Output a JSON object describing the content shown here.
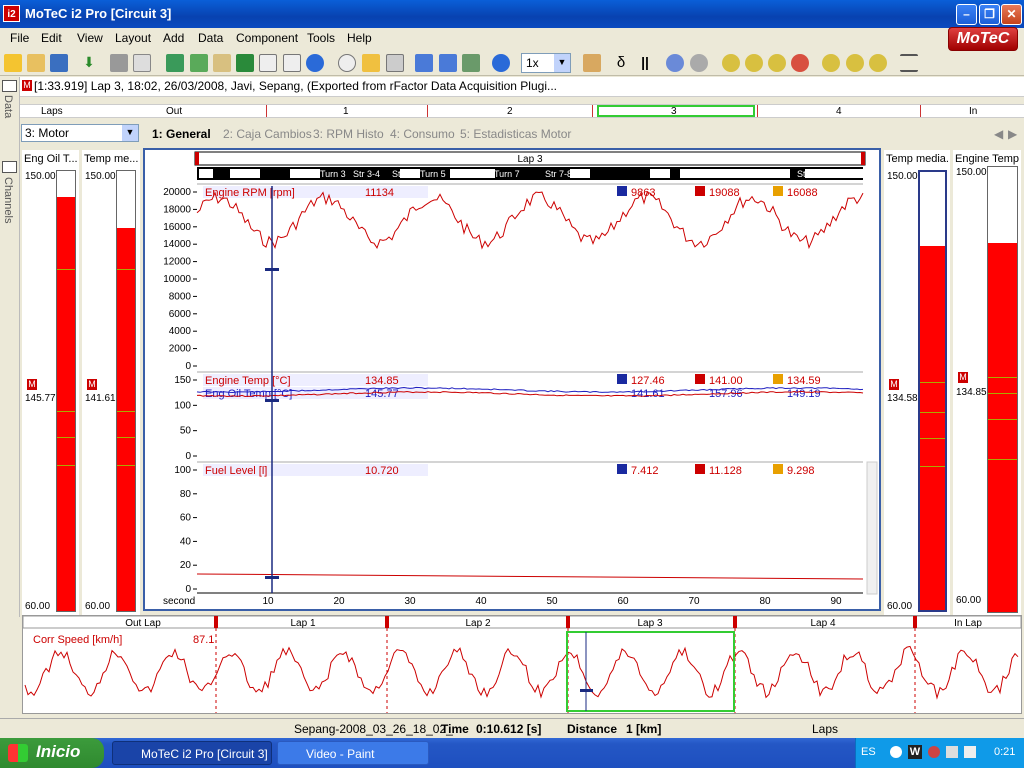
{
  "window": {
    "title": "MoTeC i2 Pro [Circuit 3]",
    "logo_text": "i2"
  },
  "menu": [
    "File",
    "Edit",
    "View",
    "Layout",
    "Add",
    "Data",
    "Component",
    "Tools",
    "Help"
  ],
  "brand": "MoTeC",
  "toolbar": {
    "zoom_value": "1x",
    "delta_label": "δ",
    "pause_label": "||"
  },
  "side_tabs": {
    "data": "Data",
    "channels": "Channels"
  },
  "info_line": "[1:33.919] Lap 3, 18:02, 26/03/2008, Javi, Sepang, (Exported from rFactor Data Acquisition Plugi...",
  "lap_strip": {
    "labels": [
      "Laps",
      "Out",
      "1",
      "2",
      "3",
      "4",
      "In"
    ]
  },
  "channel_selector": "3: Motor",
  "worksheet_tabs": [
    "1: General",
    "2: Caja Cambios",
    "3: RPM Histo",
    "4: Consumo",
    "5: Estadisticas Motor"
  ],
  "left_gauges": [
    {
      "title": "Eng Oil T...",
      "max": "150.00",
      "min": "60.00",
      "value": "145.77",
      "fraction": 0.94
    },
    {
      "title": "Temp me...",
      "max": "150.00",
      "min": "60.00",
      "value": "141.61",
      "fraction": 0.87
    }
  ],
  "right_gauges": [
    {
      "title": "Temp media...",
      "max": "150.00",
      "min": "60.00",
      "value": "134.58",
      "fraction": 0.83
    },
    {
      "title": "Engine Temp",
      "max": "150.00",
      "min": "60.00",
      "value": "134.85",
      "fraction": 0.83
    }
  ],
  "plot": {
    "lap_title": "Lap 3",
    "track_segments": [
      "Turn 3",
      "Str 3-4",
      "Str 4-5",
      "Turn 5",
      "Turn 7",
      "Str 7-8",
      "Str 0-1"
    ],
    "x_axis_label": "second",
    "x_ticks": [
      "10",
      "20",
      "30",
      "40",
      "50",
      "60",
      "70",
      "80",
      "90"
    ],
    "panes": [
      {
        "channels": [
          {
            "name": "Engine RPM [rpm]",
            "color": "#cc0000",
            "cursor": "11134",
            "min": "9863",
            "max": "19088",
            "avg": "16088"
          }
        ],
        "y_ticks": [
          "20000",
          "18000",
          "16000",
          "14000",
          "12000",
          "10000",
          "8000",
          "6000",
          "4000",
          "2000",
          "0"
        ]
      },
      {
        "channels": [
          {
            "name": "Engine Temp [°C]",
            "color": "#cc0000",
            "cursor": "134.85",
            "min": "127.46",
            "max": "141.00",
            "avg": "134.59"
          },
          {
            "name": "Eng Oil Temp [°C]",
            "color": "#2020c0",
            "cursor": "145.77",
            "min": "141.61",
            "max": "157.96",
            "avg": "149.19"
          }
        ],
        "y_ticks": [
          "150",
          "100",
          "50",
          "0"
        ]
      },
      {
        "channels": [
          {
            "name": "Fuel Level [l]",
            "color": "#cc0000",
            "cursor": "10.720",
            "min": "7.412",
            "max": "11.128",
            "avg": "9.298"
          }
        ],
        "y_ticks": [
          "100",
          "80",
          "60",
          "40",
          "20",
          "0"
        ]
      }
    ]
  },
  "overview": {
    "laps": [
      "Out Lap",
      "Lap 1",
      "Lap 2",
      "Lap 3",
      "Lap 4",
      "In Lap"
    ],
    "channel": "Corr Speed [km/h]",
    "channel_value": "87.1"
  },
  "status": {
    "file": "Sepang-2008_03_26_18_02_",
    "time_label": "Time",
    "time_value": "0:10.612 [s]",
    "distance_label": "Distance",
    "distance_value": "1 [km]",
    "laps": "Laps"
  },
  "taskbar": {
    "start": "Inicio",
    "tasks": [
      "MoTeC i2 Pro [Circuit 3]",
      "Video - Paint"
    ],
    "lang": "ES",
    "clock": "0:21"
  },
  "colors": {
    "trace_red": "#cc0000",
    "trace_blue": "#2020c0",
    "plot_border": "#3a5fa8",
    "gauge_fill": "#ff0000"
  }
}
